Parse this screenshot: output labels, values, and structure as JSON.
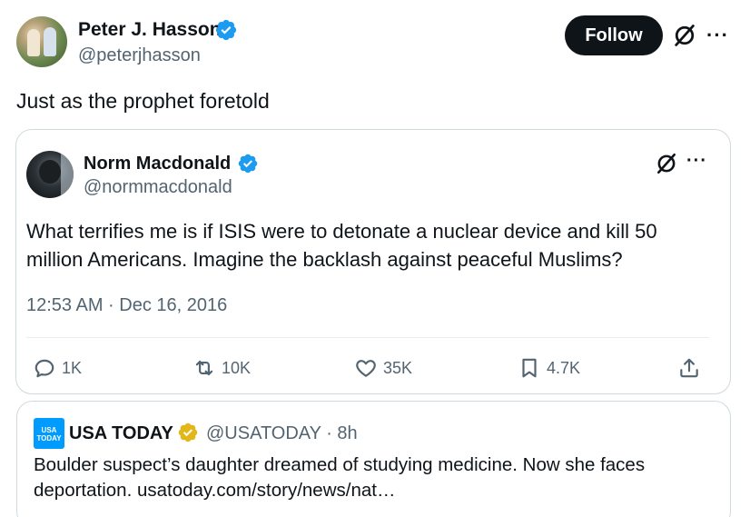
{
  "author": {
    "name": "Peter J. Hasson",
    "handle": "@peterjhasson",
    "follow_label": "Follow"
  },
  "tweet": {
    "text": "Just as the prophet foretold"
  },
  "quoted": {
    "name": "Norm Macdonald",
    "handle": "@normmacdonald",
    "text": "What terrifies me is if ISIS were to detonate a nuclear device and kill 50 million Americans. Imagine the backlash against peaceful Muslims?",
    "timestamp": "12:53 AM · Dec 16, 2016",
    "stats": {
      "replies": "1K",
      "retweets": "10K",
      "likes": "35K",
      "bookmarks": "4.7K"
    }
  },
  "link_card": {
    "logo_text": "USA TODAY",
    "name": "USA TODAY",
    "handle_time": "@USATODAY · 8h",
    "text": "Boulder suspect’s daughter dreamed of studying medicine. Now she faces deportation. usatoday.com/story/news/nat…"
  },
  "icons": {
    "verified": "verified-badge-icon",
    "grok": "grok-icon",
    "more": "more-icon",
    "reply": "reply-icon",
    "retweet": "retweet-icon",
    "like": "heart-icon",
    "bookmark": "bookmark-icon",
    "share": "share-icon",
    "gold_badge": "gold-verified-badge-icon"
  },
  "colors": {
    "verified_blue": "#1d9bf0",
    "gold": "#e2b719",
    "text": "#0f1419",
    "muted": "#536471",
    "usat_blue": "#009bff"
  }
}
